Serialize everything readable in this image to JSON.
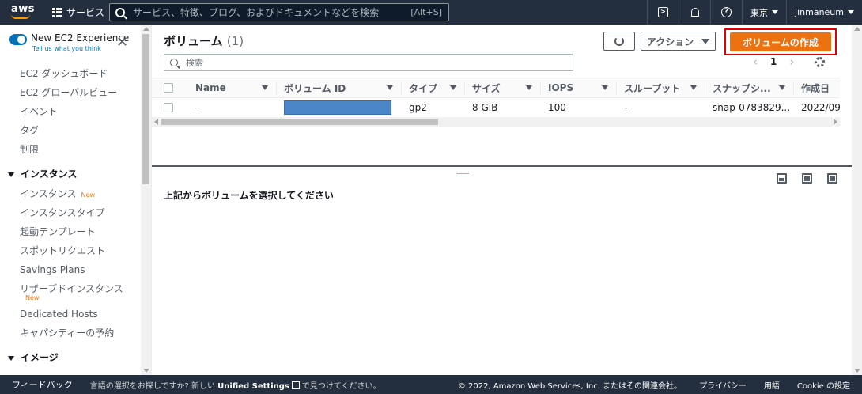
{
  "nav": {
    "logo": "aws",
    "services": "サービス",
    "search_placeholder": "サービス、特徴、ブログ、およびドキュメントなどを検索",
    "search_shortcut": "[Alt+S]",
    "region": "東京",
    "user": "jinmaneum"
  },
  "sidebar": {
    "toggle_label": "New EC2 Experience",
    "toggle_sub": "Tell us what you think",
    "items_top": [
      "EC2 ダッシュボード",
      "EC2 グローバルビュー",
      "イベント",
      "タグ",
      "制限"
    ],
    "section_instances": "インスタンス",
    "instances_items": [
      "インスタンス",
      "インスタンスタイプ",
      "起動テンプレート",
      "スポットリクエスト",
      "Savings Plans",
      "リザーブドインスタンス"
    ],
    "new_badge": "New",
    "items_after": [
      "Dedicated Hosts",
      "キャパシティーの予約"
    ],
    "section_images": "イメージ"
  },
  "panel": {
    "title": "ボリューム",
    "count": "(1)",
    "actions_label": "アクション",
    "create_label": "ボリュームの作成",
    "filter_placeholder": "検索",
    "page": "1",
    "columns": [
      "Name",
      "ボリューム ID",
      "タイプ",
      "サイズ",
      "IOPS",
      "スループット",
      "スナップシ...",
      "作成日"
    ],
    "row": {
      "name": "–",
      "volume_id": "",
      "type": "gp2",
      "size": "8 GiB",
      "iops": "100",
      "throughput": "-",
      "snapshot": "snap-0783829...",
      "created": "2022/09/"
    },
    "detail_message": "上記からボリュームを選択してください"
  },
  "footer": {
    "feedback": "フィードバック",
    "lang_prefix": "言語の選択をお探しですか? 新しい",
    "unified": "Unified Settings",
    "lang_suffix": "で見つけてください。",
    "copyright": "© 2022, Amazon Web Services, Inc. またはその関連会社。",
    "privacy": "プライバシー",
    "terms": "用語",
    "cookie": "Cookie の設定"
  },
  "colors": {
    "nav_bg": "#232f3e",
    "accent": "#ec7211",
    "link": "#0073bb",
    "highlight": "#e00000"
  }
}
